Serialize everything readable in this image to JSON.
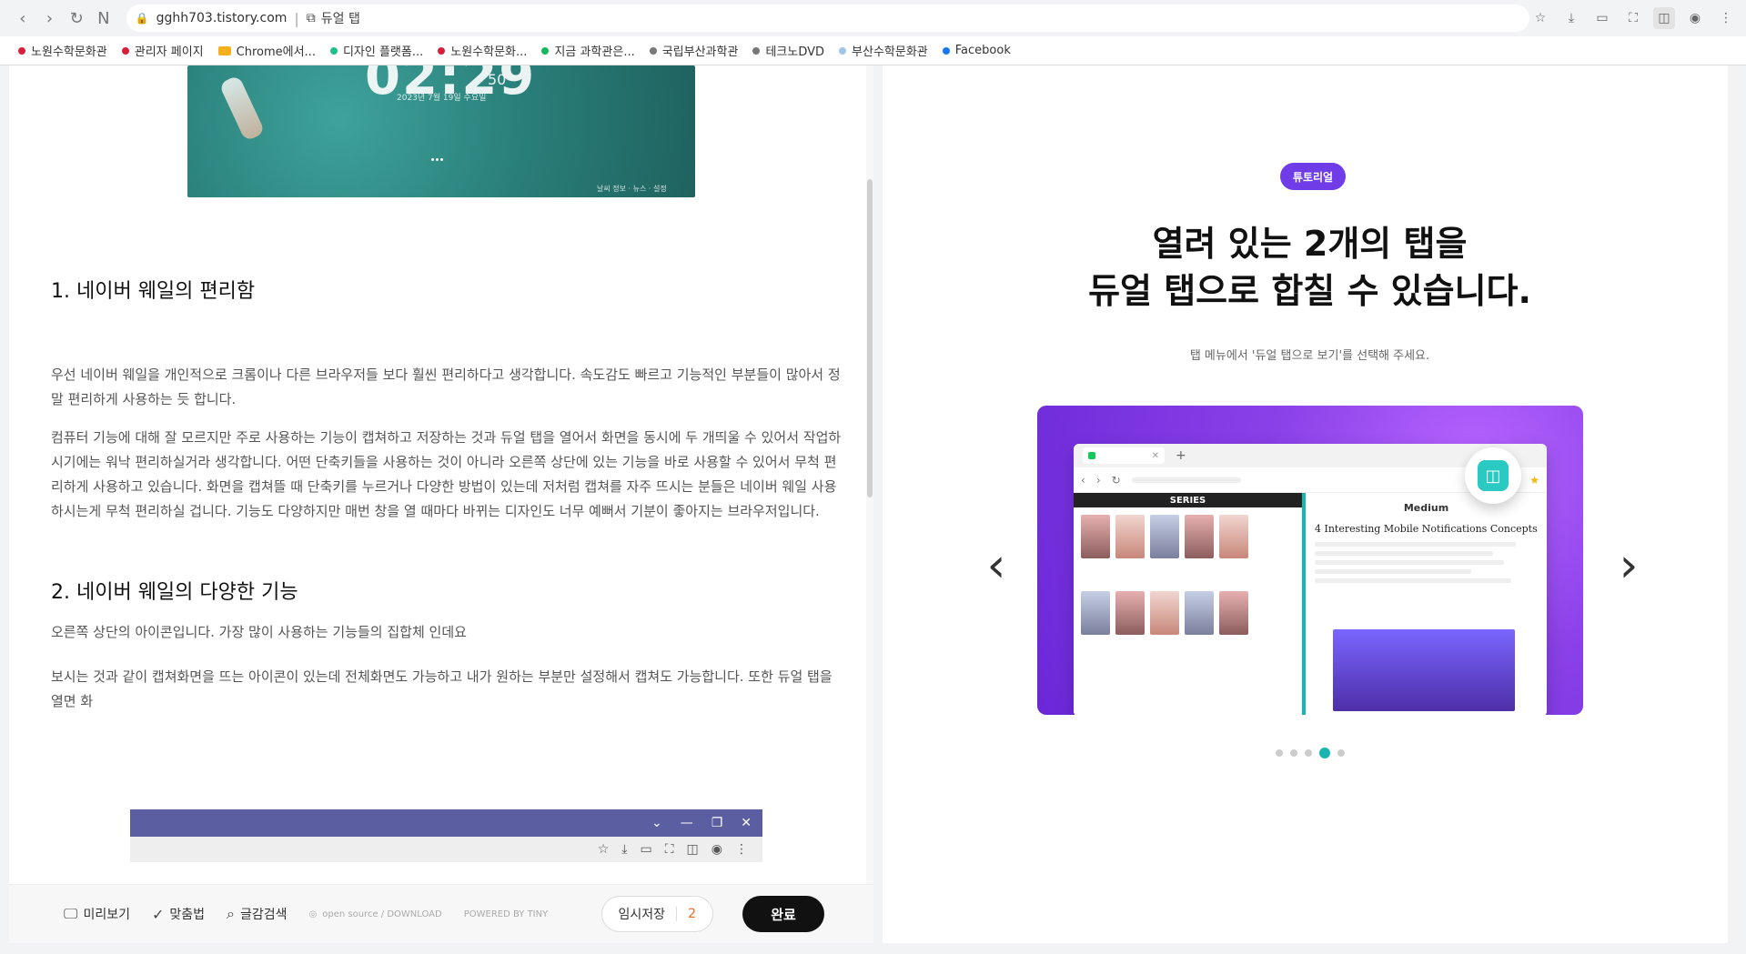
{
  "browser": {
    "url": "gghh703.tistory.com",
    "dual_tab_label": "듀얼 탭"
  },
  "bookmarks": [
    {
      "label": "노원수학문화관",
      "color": "#d71f3b"
    },
    {
      "label": "관리자 페이지",
      "color": "#d71f3b"
    },
    {
      "label": "Chrome에서...",
      "color": "#f2b01e",
      "folder": true
    },
    {
      "label": "디자인 플랫폼...",
      "color": "#1ebf8b"
    },
    {
      "label": "노원수학문화...",
      "color": "#d71f3b"
    },
    {
      "label": "지금 과학관은...",
      "color": "#17b85b"
    },
    {
      "label": "국립부산과학관",
      "color": "#777777"
    },
    {
      "label": "테크노DVD",
      "color": "#777777"
    },
    {
      "label": "부산수학문화관",
      "color": "#9ec7e8"
    },
    {
      "label": "Facebook",
      "color": "#1877f2"
    }
  ],
  "left": {
    "hero": {
      "clock": "02:29",
      "sec": "50",
      "date": "2023년 7월 19일 수요일",
      "footer": "날씨 정보 · 뉴스 · 설정"
    },
    "h1": "1. 네이버 웨일의 편리함",
    "p1": "우선 네이버 웨일을 개인적으로 크롬이나 다른 브라우저들 보다 훨씬 편리하다고 생각합니다. 속도감도 빠르고 기능적인 부분들이 많아서 정말 편리하게 사용하는 듯 합니다.",
    "p2": "컴퓨터 기능에 대해 잘 모르지만 주로 사용하는 기능이 캡쳐하고 저장하는 것과 듀얼 탭을 열어서 화면을 동시에 두 개띄울 수 있어서 작업하시기에는 워낙 편리하실거라 생각합니다. 어떤 단축키들을 사용하는 것이 아니라 오른쪽 상단에 있는 기능을 바로 사용할 수 있어서 무척 편리하게 사용하고 있습니다. 화면을 캡쳐뜰 때 단축키를 누르거나 다양한 방법이 있는데 저처럼 캡쳐를 자주 뜨시는 분들은 네이버 웨일 사용하시는게 무척 편리하실 겁니다. 기능도 다양하지만 매번 창을 열 때마다 바뀌는 디자인도 너무 예뻐서 기분이 좋아지는 브라우저입니다.",
    "h2": "2. 네이버 웨일의 다양한 기능",
    "p3": "오른쪽 상단의 아이콘입니다. 가장 많이 사용하는 기능들의 집합체 인데요",
    "p4": "보시는 것과 같이 캡쳐화면을 뜨는 아이콘이 있는데 전체화면도 가능하고 내가 원하는 부분만 설정해서 캡쳐도 가능합니다. 또한 듀얼 탭을 열면 화"
  },
  "toolbar": {
    "preview": "미리보기",
    "spell": "맞춤법",
    "search": "글감검색",
    "opensource": "open source / DOWNLOAD",
    "powered": "POWERED BY TINY",
    "save_label": "임시저장",
    "save_count": "2",
    "done_label": "완료"
  },
  "right": {
    "badge": "튜토리얼",
    "title_line1": "열려 있는 2개의 탭을",
    "title_line2": "듀얼 탭으로 합칠 수 있습니다.",
    "subtitle": "탭 메뉴에서 '듀얼 탭으로 보기'를 선택해 주세요.",
    "slide_header": "SERIES",
    "slide_medium": "Medium",
    "slide_article": "4 Interesting Mobile Notifications Concepts",
    "pager": [
      false,
      false,
      false,
      true,
      false
    ]
  }
}
